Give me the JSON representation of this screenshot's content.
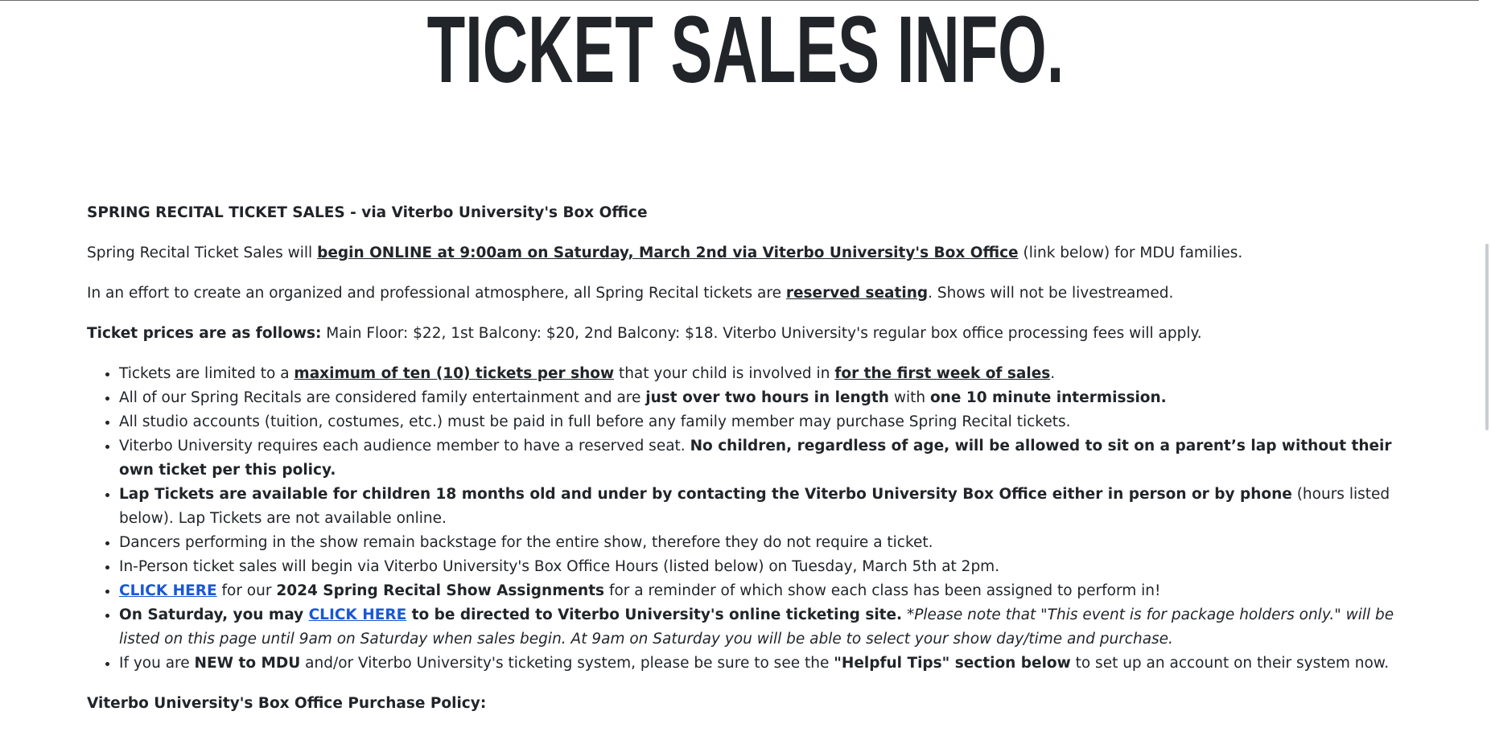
{
  "page": {
    "title": "TICKET SALES INFO."
  },
  "section": {
    "heading": "SPRING RECITAL TICKET SALES - via Viterbo University's Box Office",
    "p1": {
      "pre": "Spring Recital Ticket Sales will ",
      "strong": "begin ONLINE at 9:00am on Saturday, March 2nd via Viterbo University's Box Office",
      "post": " (link below) for MDU families."
    },
    "p2": {
      "pre": "In an effort to create an organized and professional atmosphere, all Spring Recital tickets are ",
      "strong": "reserved seating",
      "post": ". Shows will not be livestreamed."
    },
    "p3": {
      "strong": "Ticket prices are as follows:",
      "post": " Main Floor: $22, 1st Balcony: $20, 2nd Balcony: $18. Viterbo University's regular box office processing fees will apply."
    },
    "bullets": {
      "b1": {
        "pre": "Tickets are limited to a ",
        "s1": "maximum of ten (10) tickets per show",
        "mid": " that your child is involved in ",
        "s2": "for the first week of sales",
        "post": "."
      },
      "b2": {
        "pre": "All of our Spring Recitals are considered family entertainment and are ",
        "s1": "just over two hours in length",
        "mid": " with ",
        "s2": "one 10 minute intermission."
      },
      "b3": {
        "text": "All studio accounts (tuition, costumes, etc.) must be paid in full before any family member may purchase Spring Recital tickets."
      },
      "b4": {
        "pre": "Viterbo University requires each audience member to have a reserved seat. ",
        "s1": "No children, regardless of age, will be allowed to sit on a parent’s lap without their own ticket per this policy."
      },
      "b5": {
        "s1": "Lap Tickets are available for children 18 months old and under by contacting the Viterbo University Box Office either in person or by phone",
        "post": " (hours listed below). Lap Tickets are not available online."
      },
      "b6": {
        "text": "Dancers performing in the show remain backstage for the entire show, therefore they do not require a ticket."
      },
      "b7": {
        "text": "In-Person ticket sales will begin via Viterbo University's Box Office Hours (listed below) on Tuesday, March 5th at 2pm."
      },
      "b8": {
        "link": "CLICK HERE",
        "pre": " for our ",
        "s1": "2024 Spring Recital Show Assignments",
        "post": " for a reminder of which show each class has been assigned to perform in!"
      },
      "b9": {
        "s1": "On Saturday, you may ",
        "link": "CLICK HERE",
        "s2": " to be directed to Viterbo University's online ticketing site.",
        "em": " *Please note that \"This event is for package holders only.\" will be listed on this page until 9am on Saturday when sales begin. At 9am on Saturday you will be able to select your show day/time and purchase."
      },
      "b10": {
        "pre": "If you are ",
        "s1": "NEW to MDU",
        "mid": " and/or Viterbo University's ticketing system, please be sure to see the ",
        "s2": "\"Helpful Tips\" section below",
        "post": " to set up an account on their system now."
      }
    },
    "policy_heading": "Viterbo University's Box Office Purchase Policy:"
  },
  "colors": {
    "text": "#212529",
    "link": "#1a57d6",
    "background": "#ffffff"
  }
}
